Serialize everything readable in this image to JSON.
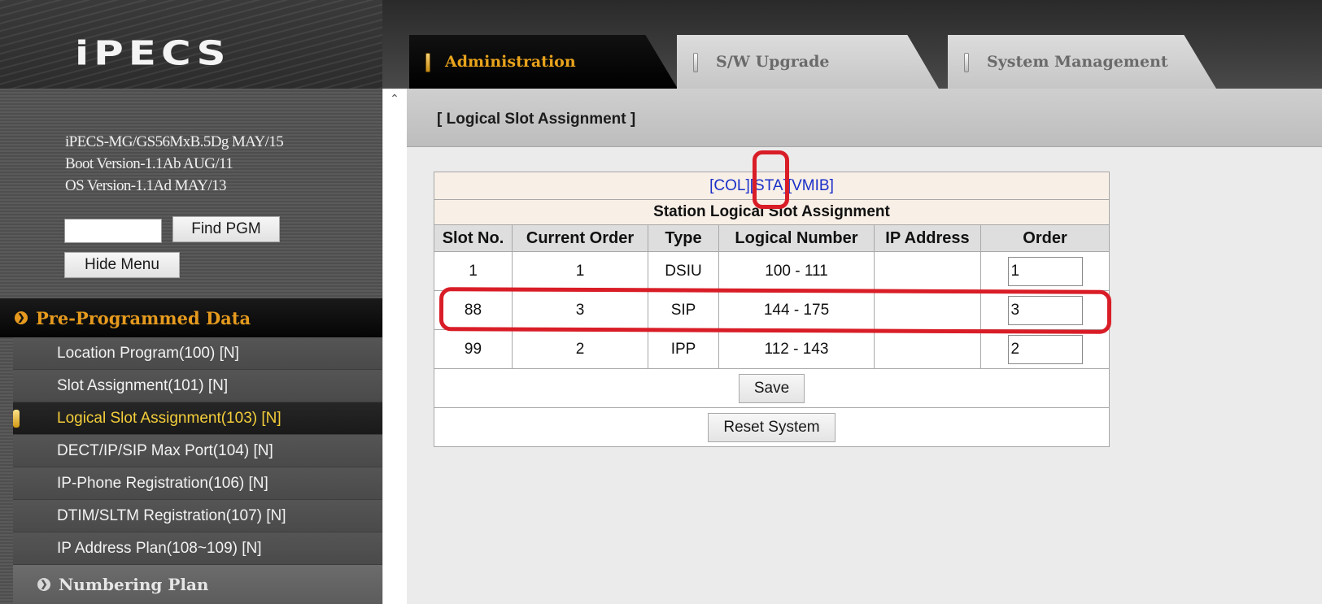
{
  "brand": {
    "logo_text": "iPECS"
  },
  "tabs": [
    {
      "label": "Administration",
      "active": true
    },
    {
      "label": "S/W Upgrade",
      "active": false
    },
    {
      "label": "System Management",
      "active": false
    }
  ],
  "sidebar": {
    "version_lines": [
      "iPECS-MG/GS56MxB.5Dg MAY/15",
      "Boot Version-1.1Ab AUG/11",
      "OS Version-1.1Ad MAY/13"
    ],
    "pgm_input_value": "",
    "find_button": "Find PGM",
    "hide_button": "Hide Menu",
    "section_title": "Pre-Programmed Data",
    "items": [
      {
        "label": "Location Program(100) [N]",
        "active": false
      },
      {
        "label": "Slot Assignment(101) [N]",
        "active": false
      },
      {
        "label": "Logical Slot Assignment(103) [N]",
        "active": true
      },
      {
        "label": "DECT/IP/SIP Max Port(104) [N]",
        "active": false
      },
      {
        "label": "IP-Phone Registration(106) [N]",
        "active": false
      },
      {
        "label": "DTIM/SLTM Registration(107) [N]",
        "active": false
      },
      {
        "label": "IP Address Plan(108~109) [N]",
        "active": false
      }
    ],
    "next_section_title": "Numbering Plan"
  },
  "main": {
    "page_title": "[ Logical Slot Assignment ]",
    "filters": [
      "[COL]",
      "[STA]",
      "[VMIB]"
    ],
    "table_caption": "Station Logical Slot Assignment",
    "columns": [
      "Slot No.",
      "Current Order",
      "Type",
      "Logical Number",
      "IP Address",
      "Order"
    ],
    "rows": [
      {
        "slot": "1",
        "current_order": "1",
        "type": "DSIU",
        "logical_number": "100 - 111",
        "ip": "",
        "order": "1"
      },
      {
        "slot": "88",
        "current_order": "3",
        "type": "SIP",
        "logical_number": "144 - 175",
        "ip": "",
        "order": "3"
      },
      {
        "slot": "99",
        "current_order": "2",
        "type": "IPP",
        "logical_number": "112 - 143",
        "ip": "",
        "order": "2"
      }
    ],
    "save_button": "Save",
    "reset_button": "Reset System"
  },
  "colors": {
    "accent_orange": "#e59a1e",
    "active_menu_text": "#f3cd3a",
    "annotation_red": "#d91d27",
    "link_blue": "#1a2fc9"
  }
}
